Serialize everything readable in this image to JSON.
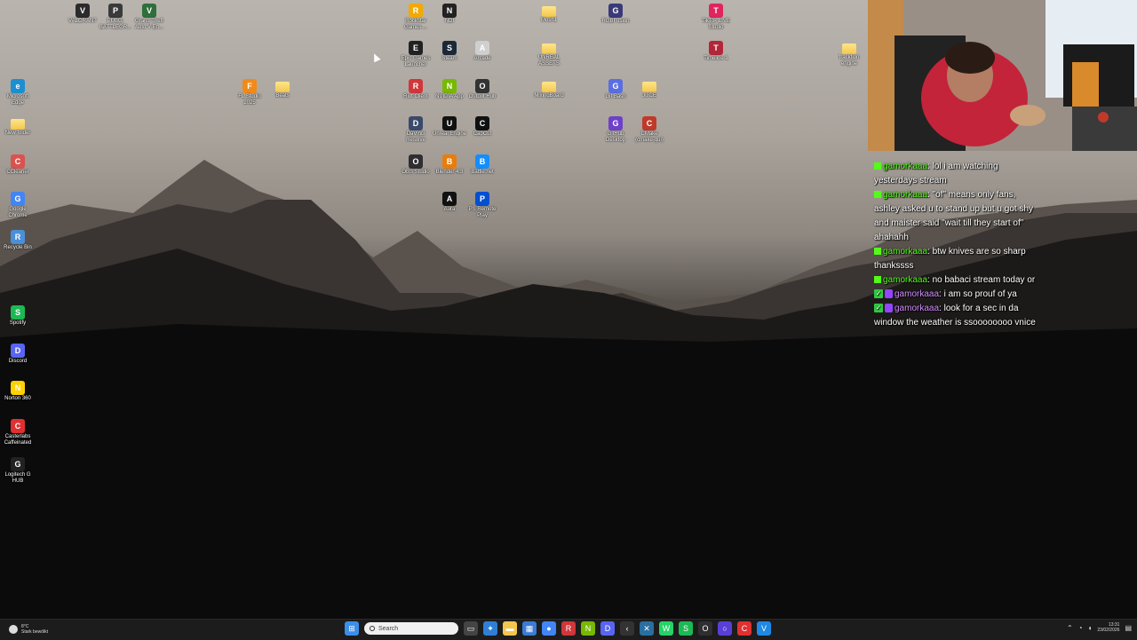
{
  "desktop_icons": [
    {
      "label": "VALORANT",
      "icon": "valorant-icon",
      "color": "#2b2b2b",
      "glyph": "V"
    },
    {
      "label": "PUBG: BATTLEGR...",
      "icon": "pubg-icon",
      "color": "#3a3a3a",
      "glyph": "P"
    },
    {
      "label": "Grand Theft Auto V En...",
      "icon": "gta-icon",
      "color": "#2f6f3a",
      "glyph": "V"
    },
    {
      "label": "Rockstar Games ...",
      "icon": "rockstar-icon",
      "color": "#f2a900",
      "glyph": "R"
    },
    {
      "label": "NDI",
      "icon": "ndi-icon",
      "color": "#222222",
      "glyph": "N"
    },
    {
      "label": "Mosh1",
      "icon": "folder-icon",
      "color": "#f3c74d",
      "glyph": ""
    },
    {
      "label": "RGBFusion",
      "icon": "rgbfusion-icon",
      "color": "#3a3a7a",
      "glyph": "G"
    },
    {
      "label": "TikTok LIVE Studio",
      "icon": "tiktok-icon",
      "color": "#e0245e",
      "glyph": "T"
    },
    {
      "label": "Epic Games Launcher",
      "icon": "epic-icon",
      "color": "#222222",
      "glyph": "E"
    },
    {
      "label": "Steam",
      "icon": "steam-icon",
      "color": "#1b2838",
      "glyph": "S"
    },
    {
      "label": "Arcade",
      "icon": "arcade-icon",
      "color": "#cfcfcf",
      "glyph": "A"
    },
    {
      "label": "UNREAL ASSETS",
      "icon": "folder-icon",
      "color": "#f3c74d",
      "glyph": ""
    },
    {
      "label": "Timeline 1",
      "icon": "timeline-icon",
      "color": "#b3263a",
      "glyph": "T"
    },
    {
      "label": "tracktion engine",
      "icon": "folder-icon",
      "color": "#f3c74d",
      "glyph": ""
    },
    {
      "label": "Microsoft Edge",
      "icon": "edge-icon",
      "color": "#1d8fd1",
      "glyph": "e"
    },
    {
      "label": "FL Studio 2025",
      "icon": "flstudio-icon",
      "color": "#f28a1a",
      "glyph": "F"
    },
    {
      "label": "Beats",
      "icon": "folder-icon",
      "color": "#f3c74d",
      "glyph": ""
    },
    {
      "label": "Riot Client",
      "icon": "riot-icon",
      "color": "#d13639",
      "glyph": "R"
    },
    {
      "label": "NVIDIA App",
      "icon": "nvidia-icon",
      "color": "#76b900",
      "glyph": "N"
    },
    {
      "label": "Output Hub",
      "icon": "outputhub-icon",
      "color": "#333333",
      "glyph": "O"
    },
    {
      "label": "MixingBoard",
      "icon": "folder-icon",
      "color": "#f3c74d",
      "glyph": ""
    },
    {
      "label": "Git Bash",
      "icon": "gitbash-icon",
      "color": "#5b6ee1",
      "glyph": "G"
    },
    {
      "label": "JUCE",
      "icon": "folder-icon",
      "color": "#f3c74d",
      "glyph": ""
    },
    {
      "label": "New folder",
      "icon": "folder-icon",
      "color": "#f3c74d",
      "glyph": ""
    },
    {
      "label": "DaVinci Resolve",
      "icon": "davinci-icon",
      "color": "#3a4a6a",
      "glyph": "D"
    },
    {
      "label": "Unreal Engine",
      "icon": "unreal-icon",
      "color": "#111111",
      "glyph": "U"
    },
    {
      "label": "CapCut",
      "icon": "capcut-icon",
      "color": "#111111",
      "glyph": "C"
    },
    {
      "label": "GitHub Desktop",
      "icon": "github-icon",
      "color": "#6e40c9",
      "glyph": "G"
    },
    {
      "label": "CMake (cmake-gui)",
      "icon": "cmake-icon",
      "color": "#c0392b",
      "glyph": "C"
    },
    {
      "label": "CCleaner",
      "icon": "ccleaner-icon",
      "color": "#d9534f",
      "glyph": "C"
    },
    {
      "label": "OBS Studio",
      "icon": "obs-icon",
      "color": "#302e31",
      "glyph": "O"
    },
    {
      "label": "Blender 4.3",
      "icon": "blender-icon",
      "color": "#e87d0d",
      "glyph": "B"
    },
    {
      "label": "Battle.net",
      "icon": "battlenet-icon",
      "color": "#148eff",
      "glyph": "B"
    },
    {
      "label": "Google Chrome",
      "icon": "chrome-icon",
      "color": "#4285f4",
      "glyph": "G"
    },
    {
      "label": "Aura",
      "icon": "aura-icon",
      "color": "#111111",
      "glyph": "A"
    },
    {
      "label": "PS Remote Play",
      "icon": "psremote-icon",
      "color": "#0050d0",
      "glyph": "P"
    },
    {
      "label": "Recycle Bin",
      "icon": "recycle-bin-icon",
      "color": "#4a90d9",
      "glyph": "R"
    },
    {
      "label": "Spotify",
      "icon": "spotify-icon",
      "color": "#1db954",
      "glyph": "S"
    },
    {
      "label": "Discord",
      "icon": "discord-icon",
      "color": "#5865f2",
      "glyph": "D"
    },
    {
      "label": "Norton 360",
      "icon": "norton-icon",
      "color": "#ffd100",
      "glyph": "N"
    },
    {
      "label": "Casterlabs Caffeinated",
      "icon": "casterlabs-icon",
      "color": "#e03030",
      "glyph": "C"
    },
    {
      "label": "Logitech G HUB",
      "icon": "logitech-icon",
      "color": "#222222",
      "glyph": "G"
    }
  ],
  "chat": [
    {
      "badges": [
        "kick"
      ],
      "user": "gamorkaaa",
      "platform": "kick",
      "text": "lol i am watching yesterdays stream"
    },
    {
      "badges": [
        "kick"
      ],
      "user": "gamorkaaa",
      "platform": "kick",
      "text": "\"of\" means only fans, ashley asked u to stand up but u got shy and maister said \"wait till they start of\" ahahahh"
    },
    {
      "badges": [
        "kick"
      ],
      "user": "gamorkaaa",
      "platform": "kick",
      "text": "btw knives are so sharp thankssss"
    },
    {
      "badges": [
        "kick"
      ],
      "user": "gamorkaaa",
      "platform": "kick",
      "text": "no babaci stream today or"
    },
    {
      "badges": [
        "check",
        "twitch"
      ],
      "user": "gamorkaaa",
      "platform": "twitch",
      "text": "i am so prouf of ya"
    },
    {
      "badges": [
        "check",
        "twitch"
      ],
      "user": "gamorkaaa",
      "platform": "twitch",
      "text": "look for a sec in da window the weather is ssoooooooo vnice"
    }
  ],
  "taskbar": {
    "weather_temp": "8°C",
    "weather_desc": "Stark bewölkt",
    "search_placeholder": "Search",
    "clock_time": "13:31",
    "clock_date": "23/02/2026",
    "apps": [
      {
        "icon": "start-icon",
        "color": "#3b8eea",
        "glyph": "⊞"
      },
      {
        "icon": "task-view-icon",
        "color": "#444444",
        "glyph": "▭"
      },
      {
        "icon": "copilot-icon",
        "color": "#2f7fd6",
        "glyph": "✦"
      },
      {
        "icon": "file-explorer-icon",
        "color": "#f3c74d",
        "glyph": "▬"
      },
      {
        "icon": "store-icon",
        "color": "#3a7bd5",
        "glyph": "▦"
      },
      {
        "icon": "chrome-icon",
        "color": "#4285f4",
        "glyph": "●"
      },
      {
        "icon": "riot-icon",
        "color": "#d13639",
        "glyph": "R"
      },
      {
        "icon": "nvidia-icon",
        "color": "#76b900",
        "glyph": "N"
      },
      {
        "icon": "discord-icon",
        "color": "#5865f2",
        "glyph": "D"
      },
      {
        "icon": "back-icon",
        "color": "#333333",
        "glyph": "‹"
      },
      {
        "icon": "tool-icon",
        "color": "#2a6fa0",
        "glyph": "✕"
      },
      {
        "icon": "whatsapp-icon",
        "color": "#25d366",
        "glyph": "W"
      },
      {
        "icon": "spotify-icon",
        "color": "#1db954",
        "glyph": "S"
      },
      {
        "icon": "obs-icon",
        "color": "#302e31",
        "glyph": "O"
      },
      {
        "icon": "circle-app-icon",
        "color": "#5a3fd6",
        "glyph": "○"
      },
      {
        "icon": "casterlabs-icon",
        "color": "#e03030",
        "glyph": "C"
      },
      {
        "icon": "vscode-icon",
        "color": "#1e88e5",
        "glyph": "V"
      }
    ]
  }
}
